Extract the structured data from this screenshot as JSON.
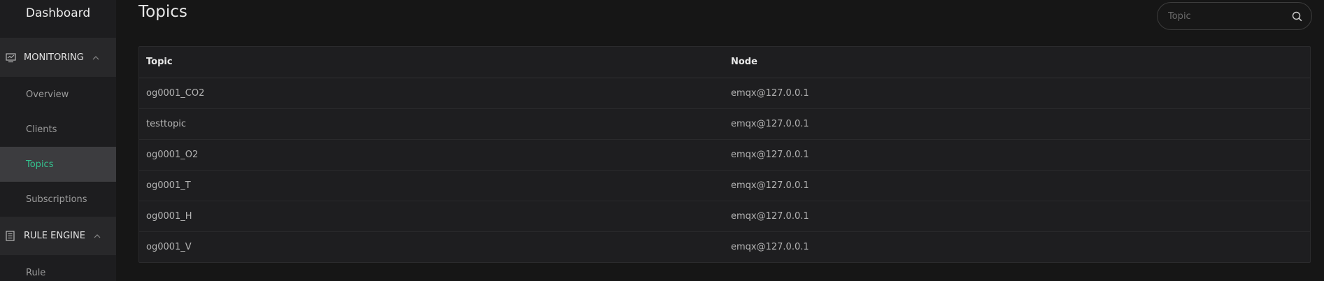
{
  "sidebar": {
    "brand": "Dashboard",
    "groups": [
      {
        "label": "MONITORING",
        "items": [
          {
            "label": "Overview"
          },
          {
            "label": "Clients"
          },
          {
            "label": "Topics"
          },
          {
            "label": "Subscriptions"
          }
        ]
      },
      {
        "label": "RULE ENGINE",
        "items": [
          {
            "label": "Rule"
          }
        ]
      }
    ],
    "active_item": "Topics",
    "accent_color": "#34c38f"
  },
  "main": {
    "title": "Topics",
    "search": {
      "placeholder": "Topic",
      "value": ""
    },
    "table": {
      "headers": [
        "Topic",
        "Node"
      ],
      "rows": [
        [
          "og0001_CO2",
          "emqx@127.0.0.1"
        ],
        [
          "testtopic",
          "emqx@127.0.0.1"
        ],
        [
          "og0001_O2",
          "emqx@127.0.0.1"
        ],
        [
          "og0001_T",
          "emqx@127.0.0.1"
        ],
        [
          "og0001_H",
          "emqx@127.0.0.1"
        ],
        [
          "og0001_V",
          "emqx@127.0.0.1"
        ]
      ]
    }
  },
  "icons": {
    "monitoring": "monitor-icon",
    "rule_engine": "document-icon",
    "chevron": "chevron-up-icon",
    "search": "search-icon"
  }
}
